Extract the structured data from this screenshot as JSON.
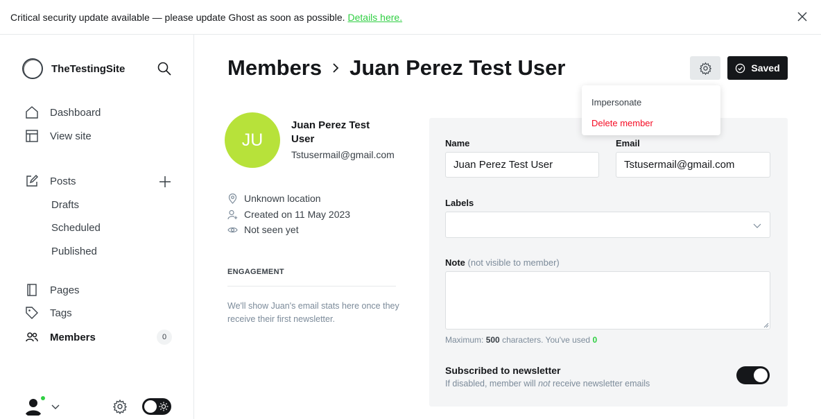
{
  "banner": {
    "message": "Critical security update available — please update Ghost as soon as possible.",
    "link": "Details here."
  },
  "sidebar": {
    "site_name": "TheTestingSite",
    "nav": {
      "dashboard": "Dashboard",
      "view_site": "View site",
      "posts": "Posts",
      "drafts": "Drafts",
      "scheduled": "Scheduled",
      "published": "Published",
      "pages": "Pages",
      "tags": "Tags",
      "members": "Members",
      "members_count": "0"
    }
  },
  "header": {
    "breadcrumb_parent": "Members",
    "breadcrumb_current": "Juan Perez Test User",
    "saved_label": "Saved"
  },
  "settings_menu": {
    "impersonate": "Impersonate",
    "delete": "Delete member"
  },
  "member": {
    "initials": "JU",
    "name": "Juan Perez Test User",
    "email": "Tstusermail@gmail.com",
    "location": "Unknown location",
    "created": "Created on 11 May 2023",
    "last_seen": "Not seen yet"
  },
  "engagement": {
    "title": "ENGAGEMENT",
    "text": "We'll show Juan's email stats here once they receive their first newsletter."
  },
  "form": {
    "name_label": "Name",
    "name_value": "Juan Perez Test User",
    "email_label": "Email",
    "email_value": "Tstusermail@gmail.com",
    "labels_label": "Labels",
    "note_label": "Note",
    "note_hint": "(not visible to member)",
    "note_value": "",
    "max_prefix": "Maximum:",
    "max_value": "500",
    "max_mid": "characters. You've used",
    "used_value": "0",
    "newsletter_title": "Subscribed to newsletter",
    "newsletter_desc_before": "If disabled, member will",
    "newsletter_desc_em": "not",
    "newsletter_desc_after": "receive newsletter emails",
    "newsletter_enabled": true
  },
  "colors": {
    "accent": "#30cf43",
    "avatar_bg": "#b7e23a",
    "danger": "#f50b23",
    "dark": "#15171a"
  }
}
